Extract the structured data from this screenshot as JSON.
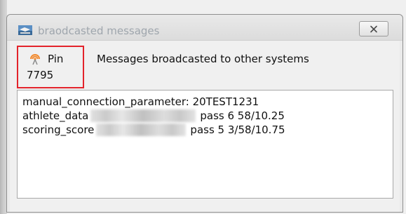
{
  "window": {
    "title": "braodcasted messages",
    "close_glyph": "✕",
    "app_icon": "broadcast-app-icon"
  },
  "pin": {
    "label": "Pin",
    "value": "7795",
    "icon": "broadcast-pin-icon",
    "highlight_color": "#e3232b"
  },
  "header": {
    "text": "Messages broadcasted to other systems"
  },
  "messages": {
    "line1": "manual_connection_parameter: 20TEST1231",
    "line2_prefix": "athlete_data",
    "line2_suffix": "pass 6 58/10.25",
    "line3_prefix": "scoring_score",
    "line3_suffix": "pass 5 3/58/10.75"
  }
}
